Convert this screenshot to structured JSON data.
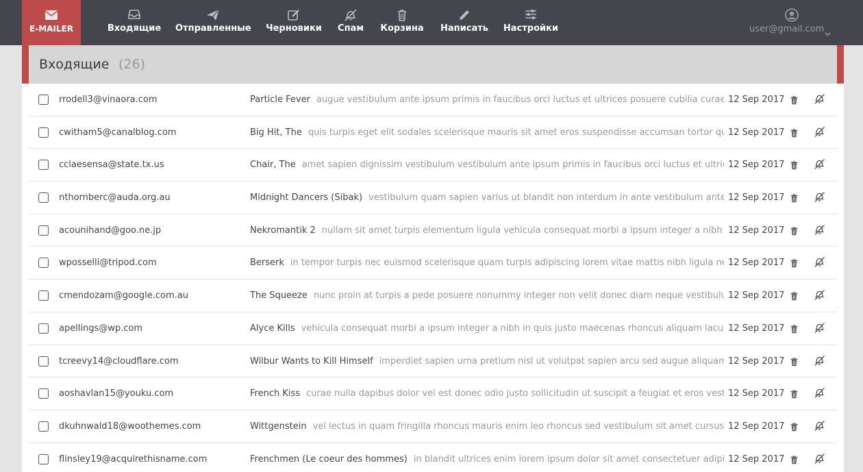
{
  "brand": {
    "label": "E-MAILER",
    "icon": "envelope-icon"
  },
  "nav": [
    {
      "label": "Входящие",
      "icon": "inbox-icon"
    },
    {
      "label": "Отправленные",
      "icon": "paper-plane-icon"
    },
    {
      "label": "Черновики",
      "icon": "pencil-square-icon"
    },
    {
      "label": "Спам",
      "icon": "bell-slash-icon"
    },
    {
      "label": "Корзина",
      "icon": "trash-icon"
    },
    {
      "label": "Написать",
      "icon": "pencil-icon"
    },
    {
      "label": "Настройки",
      "icon": "sliders-icon"
    }
  ],
  "user": {
    "email": "user@gmail.com",
    "icon": "user-circle-icon"
  },
  "folder": {
    "title": "Входящие",
    "count": "(26)"
  },
  "messages": [
    {
      "from": "rrodell3@vinaora.com",
      "subject": "Particle Fever",
      "preview": "augue vestibulum ante ipsum primis in faucibus orci luctus et ultrices posuere cubilia curae donec pharetra",
      "date": "12 Sep 2017"
    },
    {
      "from": "cwitham5@canalblog.com",
      "subject": "Big Hit, The",
      "preview": "quis turpis eget elit sodales scelerisque mauris sit amet eros suspendisse accumsan tortor quis turpis sed",
      "date": "12 Sep 2017"
    },
    {
      "from": "cclaesensa@state.tx.us",
      "subject": "Chair, The",
      "preview": "amet sapien dignissim vestibulum vestibulum ante ipsum primis in faucibus orci luctus et ultrices posuere",
      "date": "12 Sep 2017"
    },
    {
      "from": "nthornberc@auda.org.au",
      "subject": "Midnight Dancers (Sibak)",
      "preview": "vestibulum quam sapien varius ut blandit non interdum in ante vestibulum ante ipsum primis",
      "date": "12 Sep 2017"
    },
    {
      "from": "acounihand@goo.ne.jp",
      "subject": "Nekromantik 2",
      "preview": "nullam sit amet turpis elementum ligula vehicula consequat morbi a ipsum integer a nibh in quis justo",
      "date": "12 Sep 2017"
    },
    {
      "from": "wposselli@tripod.com",
      "subject": "Berserk",
      "preview": "in tempor turpis nec euismod scelerisque quam turpis adipiscing lorem vitae mattis nibh ligula nec sem duis",
      "date": "12 Sep 2017"
    },
    {
      "from": "cmendozam@google.com.au",
      "subject": "The Squeeze",
      "preview": "nunc proin at turpis a pede posuere nonummy integer non velit donec diam neque vestibulum eget vulputate",
      "date": "12 Sep 2017"
    },
    {
      "from": "apellings@wp.com",
      "subject": "Alyce Kills",
      "preview": "vehicula consequat morbi a ipsum integer a nibh in quis justo maecenas rhoncus aliquam lacus morbi quis",
      "date": "12 Sep 2017"
    },
    {
      "from": "tcreevy14@cloudflare.com",
      "subject": "Wilbur Wants to Kill Himself",
      "preview": "imperdiet sapien urna pretium nisl ut volutpat sapien arcu sed augue aliquam erat volutpat",
      "date": "12 Sep 2017"
    },
    {
      "from": "aoshavlan15@youku.com",
      "subject": "French Kiss",
      "preview": "curae nulla dapibus dolor vel est donec odio justo sollicitudin ut suscipit a feugiat et eros vestibulum ac",
      "date": "12 Sep 2017"
    },
    {
      "from": "dkuhnwald18@woothemes.com",
      "subject": "Wittgenstein",
      "preview": "vel lectus in quam fringilla rhoncus mauris enim leo rhoncus sed vestibulum sit amet cursus id turpis",
      "date": "12 Sep 2017"
    },
    {
      "from": "flinsley19@acquirethisname.com",
      "subject": "Frenchmen (Le coeur des hommes)",
      "preview": "in blandit ultrices enim lorem ipsum dolor sit amet consectetuer adipiscing elit",
      "date": "12 Sep 2017"
    }
  ],
  "row_actions": {
    "delete_icon": "trash-icon",
    "spam_icon": "bell-slash-icon"
  },
  "colors": {
    "topbar": "#45454e",
    "accent": "#bd4b4b",
    "header": "#d6d6d6",
    "background": "#e4e4e4"
  }
}
